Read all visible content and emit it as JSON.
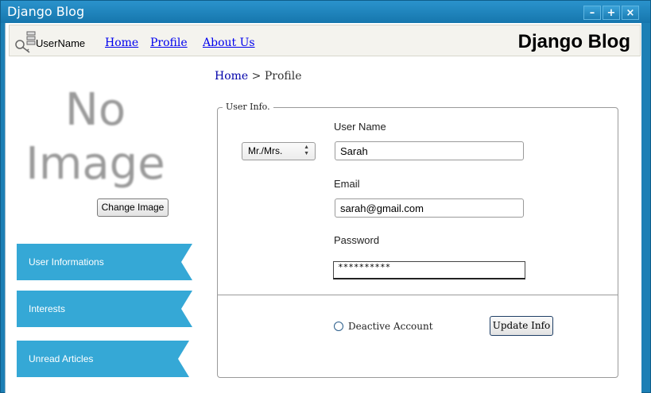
{
  "window": {
    "title": "Django Blog",
    "controls": [
      "minimize-icon",
      "maximize-icon",
      "close-icon"
    ]
  },
  "navbar": {
    "user_name": "UserName",
    "links": [
      "Home",
      "Profile",
      "About Us"
    ],
    "brand": "Django Blog"
  },
  "profile_image": {
    "placeholder_line1": "No",
    "placeholder_line2": "Image",
    "change_button": "Change Image"
  },
  "sidebar": {
    "items": [
      {
        "label": "User Informations"
      },
      {
        "label": "Interests"
      },
      {
        "label": "Unread Articles"
      }
    ]
  },
  "breadcrumb": {
    "home": "Home",
    "separator": ">",
    "current": "Profile"
  },
  "form": {
    "legend": "User Info.",
    "salutation": "Mr./Mrs.",
    "username_label": "User Name",
    "username_value": "Sarah",
    "email_label": "Email",
    "email_value": "sarah@gmail.com",
    "password_label": "Password",
    "password_value": "**********",
    "deactivate_label": "Deactive Account",
    "update_button": "Update Info"
  },
  "colors": {
    "titlebar": "#1c7fb5",
    "sidebar_item": "#35a8d6",
    "link": "#0000ee"
  }
}
